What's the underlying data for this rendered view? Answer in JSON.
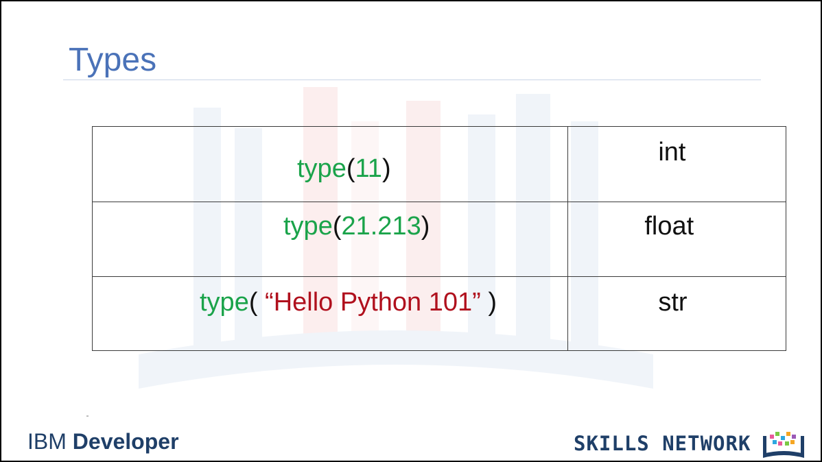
{
  "slide": {
    "title": "Types",
    "rows": [
      {
        "fn": "type",
        "open": "(",
        "arg": "11",
        "arg_kind": "num",
        "close": ")",
        "result": "int"
      },
      {
        "fn": "type",
        "open": "(",
        "arg": "21.213",
        "arg_kind": "num",
        "close": ")",
        "result": "float"
      },
      {
        "fn": "type",
        "open": "( ",
        "arg": "“Hello Python 101”",
        "arg_kind": "str",
        "close": " )",
        "result": "str"
      }
    ],
    "footer": {
      "brand": "IBM",
      "brand_suffix": "Developer",
      "network": "SKILLS NETWORK"
    }
  },
  "colors": {
    "title": "#4a72b8",
    "function": "#1aa34a",
    "number": "#1aa34a",
    "string": "#b0101d",
    "footer": "#1f3f68"
  },
  "icons": {
    "network_logo": "books-icon"
  }
}
